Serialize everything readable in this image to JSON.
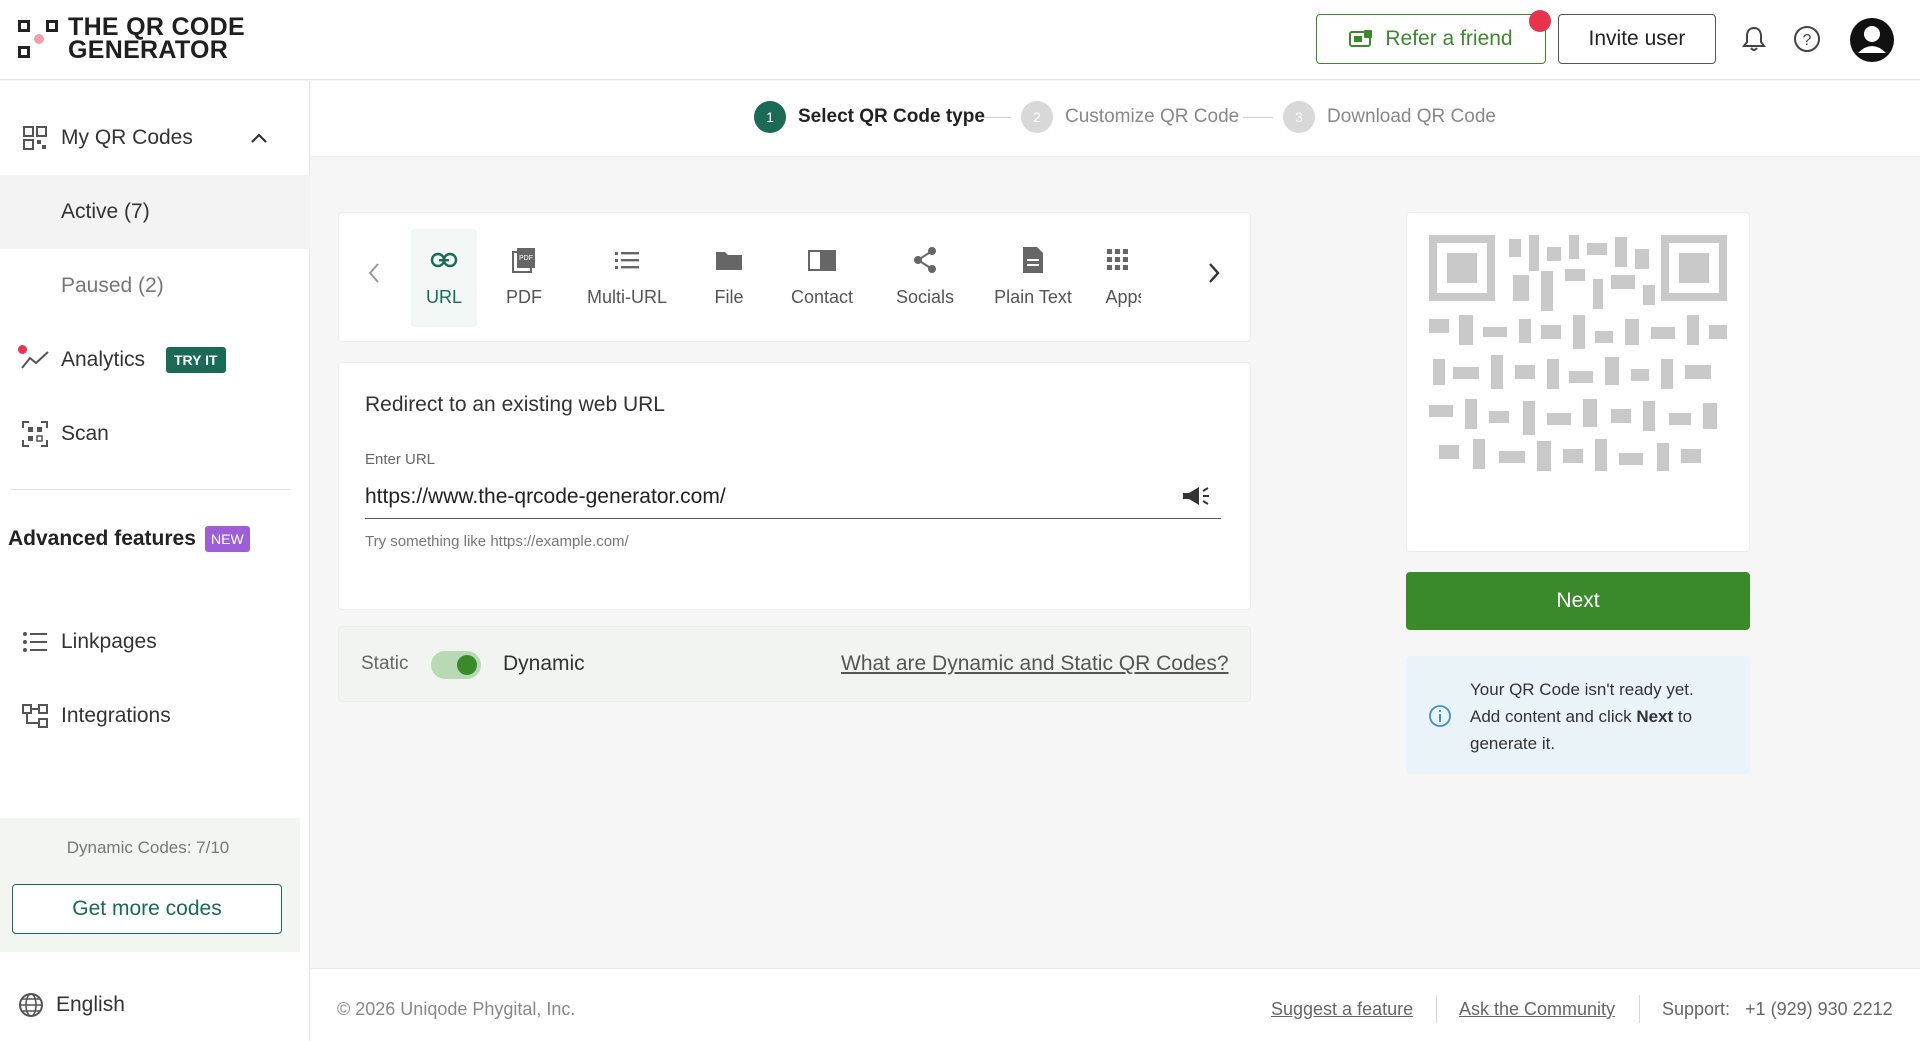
{
  "brand": {
    "line1": "THE QR CODE",
    "line2": "GENERATOR"
  },
  "header": {
    "refer_label": "Refer a friend",
    "invite_label": "Invite user"
  },
  "sidebar": {
    "my_qr_codes": "My QR Codes",
    "active": "Active (7)",
    "paused": "Paused (2)",
    "analytics": "Analytics",
    "analytics_tag": "TRY IT",
    "scan": "Scan",
    "advanced_title": "Advanced features",
    "advanced_tag": "NEW",
    "linkpages": "Linkpages",
    "integrations": "Integrations",
    "dynamic_codes": "Dynamic Codes: 7/10",
    "get_more": "Get more codes",
    "language": "English"
  },
  "steps": [
    {
      "num": "1",
      "label": "Select QR Code type"
    },
    {
      "num": "2",
      "label": "Customize QR Code"
    },
    {
      "num": "3",
      "label": "Download QR Code"
    }
  ],
  "types": [
    "URL",
    "PDF",
    "Multi-URL",
    "File",
    "Contact",
    "Socials",
    "Plain Text",
    "Apps"
  ],
  "url_form": {
    "title": "Redirect to an existing web URL",
    "label": "Enter URL",
    "value": "https://www.the-qrcode-generator.com/",
    "hint": "Try something like https://example.com/"
  },
  "mode": {
    "static": "Static",
    "dynamic": "Dynamic",
    "link": "What are Dynamic and Static QR Codes?"
  },
  "preview": {
    "next": "Next",
    "info_line1": "Your QR Code isn't ready yet.",
    "info_pre": "Add content and click ",
    "info_bold": "Next",
    "info_post": " to generate it."
  },
  "footer": {
    "copyright": "© 2026 Uniqode Phygital, Inc.",
    "suggest": "Suggest a feature",
    "community": "Ask the Community",
    "support": "Support:   +1 (929) 930 2212"
  },
  "colors": {
    "brand_green": "#3a8a2c",
    "teal": "#1a6a56",
    "badge_red": "#e8344a",
    "new_purple": "#9d5fd6"
  }
}
